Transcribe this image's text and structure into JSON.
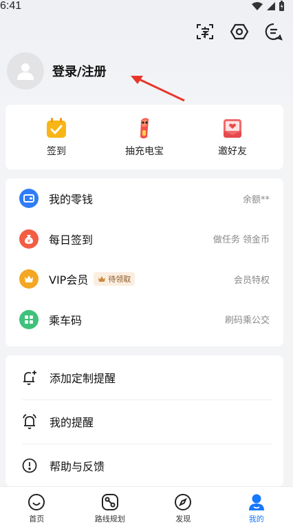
{
  "status_bar": {
    "time": "6:41"
  },
  "header": {
    "login_label": "登录/注册"
  },
  "quick_actions": [
    {
      "label": "签到",
      "icon": "calendar-check-icon"
    },
    {
      "label": "抽充电宝",
      "icon": "power-bank-icon"
    },
    {
      "label": "邀好友",
      "icon": "invite-envelope-icon"
    }
  ],
  "wallet_list": [
    {
      "title": "我的零钱",
      "right": "余额**",
      "icon": "wallet-icon",
      "color": "#2f7cf6"
    },
    {
      "title": "每日签到",
      "right": "做任务 领金币",
      "icon": "money-bag-icon",
      "color": "#f25d44"
    },
    {
      "title": "VIP会员",
      "badge": "待领取",
      "right": "会员特权",
      "icon": "crown-icon",
      "color": "#f3a724"
    },
    {
      "title": "乘车码",
      "right": "刷码乘公交",
      "icon": "qr-grid-icon",
      "color": "#3fc27b"
    }
  ],
  "settings_list": [
    {
      "title": "添加定制提醒",
      "icon": "bell-plus-icon"
    },
    {
      "title": "我的提醒",
      "icon": "alarm-bell-icon"
    },
    {
      "title": "帮助与反馈",
      "icon": "help-alert-icon"
    }
  ],
  "tabs": [
    {
      "label": "首页",
      "icon": "home-smile-icon",
      "active": false
    },
    {
      "label": "路线规划",
      "icon": "route-icon",
      "active": false
    },
    {
      "label": "发现",
      "icon": "compass-icon",
      "active": false
    },
    {
      "label": "我的",
      "icon": "profile-icon",
      "active": true
    }
  ],
  "colors": {
    "accent": "#1677ff",
    "arrow": "#e8352b"
  }
}
